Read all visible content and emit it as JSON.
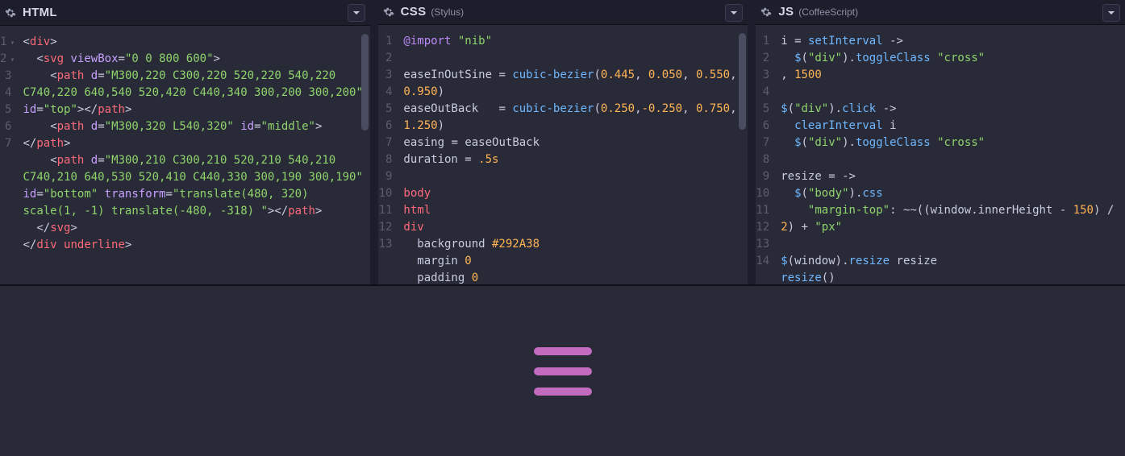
{
  "panels": {
    "html": {
      "title": "HTML",
      "sub": "",
      "lines": [
        "1",
        "2",
        "3",
        "4",
        "5",
        "6",
        "7"
      ],
      "fold_lines": [
        1,
        2
      ],
      "code": [
        [
          [
            "punc",
            "<"
          ],
          [
            "tag",
            "div"
          ],
          [
            "punc",
            ">"
          ]
        ],
        [
          [
            "punc",
            "  <"
          ],
          [
            "tag",
            "svg"
          ],
          [
            "punc",
            " "
          ],
          [
            "attr",
            "viewBox"
          ],
          [
            "punc",
            "="
          ],
          [
            "str",
            "\"0 0 800 600\""
          ],
          [
            "punc",
            ">"
          ]
        ],
        [
          [
            "punc",
            "    <"
          ],
          [
            "tag",
            "path"
          ],
          [
            "punc",
            " "
          ],
          [
            "attr",
            "d"
          ],
          [
            "punc",
            "="
          ],
          [
            "str",
            "\"M300,220 C300,220 520,220 540,220 C740,220 640,540 520,420 C440,340 300,200 300,200\""
          ],
          [
            "punc",
            " "
          ],
          [
            "attr",
            "id"
          ],
          [
            "punc",
            "="
          ],
          [
            "str",
            "\"top\""
          ],
          [
            "punc",
            "></"
          ],
          [
            "tag",
            "path"
          ],
          [
            "punc",
            ">"
          ]
        ],
        [
          [
            "punc",
            "    <"
          ],
          [
            "tag",
            "path"
          ],
          [
            "punc",
            " "
          ],
          [
            "attr",
            "d"
          ],
          [
            "punc",
            "="
          ],
          [
            "str",
            "\"M300,320 L540,320\""
          ],
          [
            "punc",
            " "
          ],
          [
            "attr",
            "id"
          ],
          [
            "punc",
            "="
          ],
          [
            "str",
            "\"middle\""
          ],
          [
            "punc",
            "></"
          ],
          [
            "tag",
            "path"
          ],
          [
            "punc",
            ">"
          ]
        ],
        [
          [
            "punc",
            "    <"
          ],
          [
            "tag",
            "path"
          ],
          [
            "punc",
            " "
          ],
          [
            "attr",
            "d"
          ],
          [
            "punc",
            "="
          ],
          [
            "str",
            "\"M300,210 C300,210 520,210 540,210 C740,210 640,530 520,410 C440,330 300,190 300,190\""
          ],
          [
            "punc",
            " "
          ],
          [
            "attr",
            "id"
          ],
          [
            "punc",
            "="
          ],
          [
            "str",
            "\"bottom\""
          ],
          [
            "punc",
            " "
          ],
          [
            "attr",
            "transform"
          ],
          [
            "punc",
            "="
          ],
          [
            "str",
            "\"translate(480, 320) scale(1, -1) translate(-480, -318) \""
          ],
          [
            "punc",
            "></"
          ],
          [
            "tag",
            "path"
          ],
          [
            "punc",
            ">"
          ]
        ],
        [
          [
            "punc",
            "  </"
          ],
          [
            "tag",
            "svg"
          ],
          [
            "punc",
            ">"
          ]
        ],
        [
          [
            "punc",
            "</"
          ],
          [
            "tag",
            "div underline"
          ],
          [
            "punc",
            ">"
          ]
        ]
      ]
    },
    "css": {
      "title": "CSS",
      "sub": "(Stylus)",
      "lines": [
        "1",
        "2",
        "3",
        "4",
        "5",
        "6",
        "7",
        "8",
        "9",
        "10",
        "11",
        "12",
        "13"
      ],
      "code": [
        [
          [
            "kw",
            "@import"
          ],
          [
            "punc",
            " "
          ],
          [
            "str",
            "\"nib\""
          ]
        ],
        [],
        [
          [
            "prop",
            "easeInOutSine "
          ],
          [
            "op",
            "="
          ],
          [
            "punc",
            " "
          ],
          [
            "fn",
            "cubic-bezier"
          ],
          [
            "punc",
            "("
          ],
          [
            "num",
            "0.445"
          ],
          [
            "punc",
            ", "
          ],
          [
            "num",
            "0.050"
          ],
          [
            "punc",
            ", "
          ],
          [
            "num",
            "0.550"
          ],
          [
            "punc",
            ", "
          ],
          [
            "num",
            "0.950"
          ],
          [
            "punc",
            ")"
          ]
        ],
        [
          [
            "prop",
            "easeOutBack   "
          ],
          [
            "op",
            "="
          ],
          [
            "punc",
            " "
          ],
          [
            "fn",
            "cubic-bezier"
          ],
          [
            "punc",
            "("
          ],
          [
            "num",
            "0.250"
          ],
          [
            "punc",
            ","
          ],
          [
            "num",
            "-0.250"
          ],
          [
            "punc",
            ", "
          ],
          [
            "num",
            "0.750"
          ],
          [
            "punc",
            ", "
          ],
          [
            "num",
            "1.250"
          ],
          [
            "punc",
            ")"
          ]
        ],
        [
          [
            "prop",
            "easing "
          ],
          [
            "op",
            "="
          ],
          [
            "punc",
            " "
          ],
          [
            "prop",
            "easeOutBack"
          ]
        ],
        [
          [
            "prop",
            "duration "
          ],
          [
            "op",
            "="
          ],
          [
            "punc",
            " "
          ],
          [
            "num",
            ".5s"
          ]
        ],
        [],
        [
          [
            "sel",
            "body"
          ]
        ],
        [
          [
            "sel",
            "html"
          ]
        ],
        [
          [
            "sel",
            "div"
          ]
        ],
        [
          [
            "punc",
            "  "
          ],
          [
            "prop",
            "background "
          ],
          [
            "num",
            "#292A38"
          ]
        ],
        [
          [
            "punc",
            "  "
          ],
          [
            "prop",
            "margin "
          ],
          [
            "num",
            "0"
          ]
        ],
        [
          [
            "punc",
            "  "
          ],
          [
            "prop",
            "padding "
          ],
          [
            "num",
            "0"
          ]
        ]
      ]
    },
    "js": {
      "title": "JS",
      "sub": "(CoffeeScript)",
      "lines": [
        "1",
        "2",
        "3",
        "4",
        "5",
        "6",
        "7",
        "8",
        "9",
        "10",
        "11",
        "12",
        "13",
        "14"
      ],
      "code": [
        [
          [
            "prop",
            "i "
          ],
          [
            "op",
            "="
          ],
          [
            "punc",
            " "
          ],
          [
            "fn",
            "setInterval"
          ],
          [
            "punc",
            " "
          ],
          [
            "op",
            "->"
          ]
        ],
        [
          [
            "punc",
            "  "
          ],
          [
            "fn",
            "$"
          ],
          [
            "punc",
            "("
          ],
          [
            "str",
            "\"div\""
          ],
          [
            "punc",
            ")."
          ],
          [
            "fn",
            "toggleClass"
          ],
          [
            "punc",
            " "
          ],
          [
            "str",
            "\"cross\""
          ]
        ],
        [
          [
            "punc",
            ", "
          ],
          [
            "num",
            "1500"
          ]
        ],
        [],
        [
          [
            "fn",
            "$"
          ],
          [
            "punc",
            "("
          ],
          [
            "str",
            "\"div\""
          ],
          [
            "punc",
            ")."
          ],
          [
            "fn",
            "click"
          ],
          [
            "punc",
            " "
          ],
          [
            "op",
            "->"
          ]
        ],
        [
          [
            "punc",
            "  "
          ],
          [
            "fn",
            "clearInterval"
          ],
          [
            "punc",
            " "
          ],
          [
            "prop",
            "i"
          ]
        ],
        [
          [
            "punc",
            "  "
          ],
          [
            "fn",
            "$"
          ],
          [
            "punc",
            "("
          ],
          [
            "str",
            "\"div\""
          ],
          [
            "punc",
            ")."
          ],
          [
            "fn",
            "toggleClass"
          ],
          [
            "punc",
            " "
          ],
          [
            "str",
            "\"cross\""
          ]
        ],
        [],
        [
          [
            "prop",
            "resize "
          ],
          [
            "op",
            "="
          ],
          [
            "punc",
            " "
          ],
          [
            "op",
            "->"
          ]
        ],
        [
          [
            "punc",
            "  "
          ],
          [
            "fn",
            "$"
          ],
          [
            "punc",
            "("
          ],
          [
            "str",
            "\"body\""
          ],
          [
            "punc",
            ")."
          ],
          [
            "fn",
            "css"
          ]
        ],
        [
          [
            "punc",
            "    "
          ],
          [
            "str",
            "\"margin-top\""
          ],
          [
            "punc",
            ": "
          ],
          [
            "op",
            "~~"
          ],
          [
            "punc",
            "(("
          ],
          [
            "prop",
            "window"
          ],
          [
            "punc",
            "."
          ],
          [
            "prop",
            "innerHeight"
          ],
          [
            "punc",
            " "
          ],
          [
            "op",
            "-"
          ],
          [
            "punc",
            " "
          ],
          [
            "num",
            "150"
          ],
          [
            "punc",
            ") "
          ],
          [
            "op",
            "/"
          ],
          [
            "punc",
            " "
          ],
          [
            "num",
            "2"
          ],
          [
            "punc",
            ") "
          ],
          [
            "op",
            "+"
          ],
          [
            "punc",
            " "
          ],
          [
            "str",
            "\"px\""
          ]
        ],
        [],
        [
          [
            "fn",
            "$"
          ],
          [
            "punc",
            "("
          ],
          [
            "prop",
            "window"
          ],
          [
            "punc",
            ")."
          ],
          [
            "fn",
            "resize"
          ],
          [
            "punc",
            " "
          ],
          [
            "prop",
            "resize"
          ]
        ],
        [
          [
            "fn",
            "resize"
          ],
          [
            "punc",
            "()"
          ]
        ]
      ]
    }
  },
  "preview": {
    "bar_color": "#c36bbf",
    "bg": "#292a38"
  }
}
